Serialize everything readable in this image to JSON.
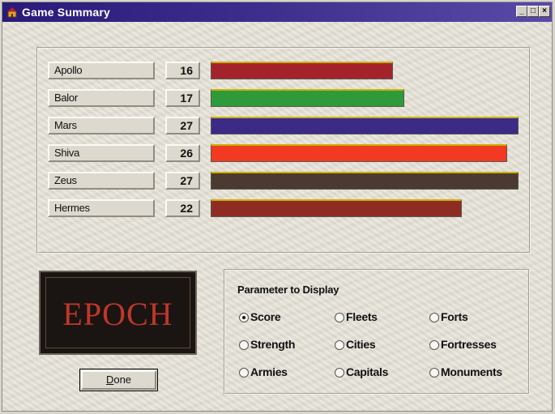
{
  "window": {
    "title": "Game Summary"
  },
  "players": [
    {
      "name": "Apollo",
      "score": "16",
      "color": "#a4232a"
    },
    {
      "name": "Balor",
      "score": "17",
      "color": "#2f9a3a"
    },
    {
      "name": "Mars",
      "score": "27",
      "color": "#3b2a86"
    },
    {
      "name": "Shiva",
      "score": "26",
      "color": "#f23a22"
    },
    {
      "name": "Zeus",
      "score": "27",
      "color": "#4b3a30"
    },
    {
      "name": "Hermes",
      "score": "22",
      "color": "#8e2c24"
    }
  ],
  "max_score": 27,
  "logo": {
    "text": "EPOCH"
  },
  "done_button": {
    "accel": "D",
    "rest": "one"
  },
  "parameters": {
    "title": "Parameter to Display",
    "options": [
      "Score",
      "Fleets",
      "Forts",
      "Strength",
      "Cities",
      "Fortresses",
      "Armies",
      "Capitals",
      "Monuments"
    ],
    "selected": "Score"
  }
}
